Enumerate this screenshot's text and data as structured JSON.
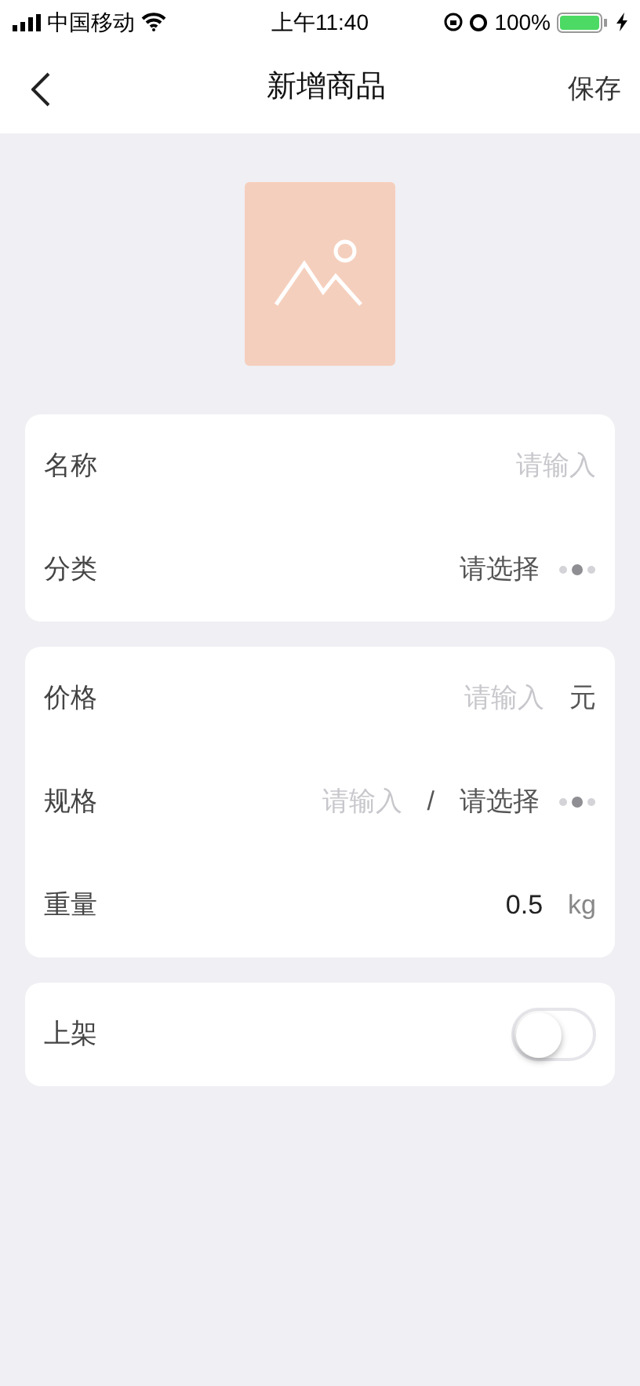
{
  "status_bar": {
    "carrier": "中国移动",
    "time": "上午11:40",
    "battery": "100%"
  },
  "nav": {
    "title": "新增商品",
    "action": "保存"
  },
  "sections": [
    {
      "rows": [
        {
          "kind": "input",
          "label": "名称",
          "placeholder": "请输入"
        },
        {
          "kind": "select",
          "label": "分类",
          "value": "请选择"
        }
      ]
    },
    {
      "rows": [
        {
          "kind": "input",
          "label": "价格",
          "placeholder": "请输入",
          "unit": "元"
        },
        {
          "kind": "spec",
          "label": "规格",
          "placeholder": "请输入",
          "separator": "/",
          "value": "请选择"
        },
        {
          "kind": "value",
          "label": "重量",
          "value": "0.5",
          "unit": "kg"
        }
      ]
    },
    {
      "rows": [
        {
          "kind": "toggle",
          "label": "上架",
          "on": false
        }
      ]
    }
  ]
}
